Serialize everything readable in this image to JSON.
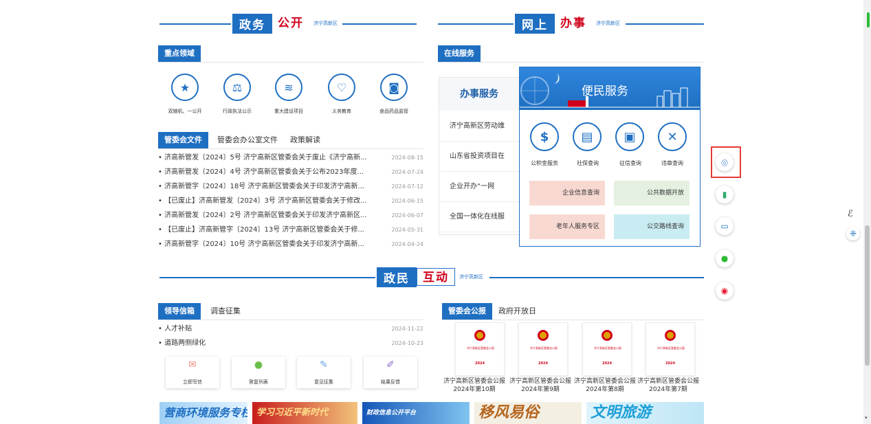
{
  "sections": {
    "gov_open": {
      "title_a": "政务",
      "title_b": "公开",
      "sub": "济宁高新区"
    },
    "online": {
      "title_a": "网上",
      "title_b": "办事",
      "sub": "济宁高新区"
    },
    "interact": {
      "title_a": "政民",
      "title_b": "互动",
      "sub": "济宁高新区"
    }
  },
  "key_areas": {
    "tab": "重点领域",
    "items": [
      {
        "label": "双随机、一公开",
        "icon": "star-badge-icon"
      },
      {
        "label": "行政执法公示",
        "icon": "gavel-icon"
      },
      {
        "label": "重大建设项目",
        "icon": "layers-icon"
      },
      {
        "label": "义务教育",
        "icon": "heart-icon"
      },
      {
        "label": "食品药品监管",
        "icon": "monitor-icon"
      }
    ]
  },
  "docs": {
    "tabs": [
      "管委会文件",
      "管委会办公室文件",
      "政策解读"
    ],
    "items": [
      {
        "title": "• 济高新管发〔2024〕5号 济宁高新区管委会关于废止《济宁高新...",
        "date": "2024-08-15"
      },
      {
        "title": "• 济高新管发〔2024〕4号 济宁高新区管委会关于公布2023年度...",
        "date": "2024-07-24"
      },
      {
        "title": "• 济高新管字〔2024〕18号 济宁高新区管委会关于印发济宁高新...",
        "date": "2024-07-12"
      },
      {
        "title": "• 【已废止】济高新管发〔2024〕3号 济宁高新区管委会关于修改...",
        "date": "2024-06-15"
      },
      {
        "title": "• 济高新管发〔2024〕2号 济宁高新区管委会关于印发济宁高新区...",
        "date": "2024-06-07"
      },
      {
        "title": "• 【已废止】济高新管字〔2024〕13号 济宁高新区管委会关于修...",
        "date": "2024-05-31"
      },
      {
        "title": "• 济高新管字〔2024〕10号 济宁高新区管委会关于印发济宁高新...",
        "date": "2024-04-24"
      }
    ]
  },
  "online_service": {
    "tab": "在线服务",
    "header": "办事服务",
    "rows": [
      "济宁高新区劳动维",
      "山东省投资项目在",
      "企业开办“一网",
      "全国一体化在线服"
    ]
  },
  "convenience": {
    "title": "便民服务",
    "items": [
      {
        "label": "公积金服务",
        "icon": "dollar-search-icon"
      },
      {
        "label": "社保查询",
        "icon": "id-card-icon"
      },
      {
        "label": "征信查询",
        "icon": "profile-card-icon"
      },
      {
        "label": "违章查询",
        "icon": "tools-icon"
      }
    ],
    "queries": [
      "企业信息查询",
      "公共数据开放",
      "老年人服务专区",
      "公交路线查询"
    ]
  },
  "leader_mail": {
    "tabs": [
      "领导信箱",
      "调查征集"
    ],
    "items": [
      {
        "title": "• 人才补贴",
        "date": "2024-11-22"
      },
      {
        "title": "• 道路两侧绿化",
        "date": "2024-10-23"
      }
    ],
    "actions": [
      {
        "label": "立即写信",
        "icon": "envelope-icon"
      },
      {
        "label": "答复列表",
        "icon": "microphone-icon"
      },
      {
        "label": "意见征集",
        "icon": "edit-doc-icon"
      },
      {
        "label": "结果反馈",
        "icon": "pen-icon"
      }
    ]
  },
  "bulletin": {
    "tabs": [
      "管委会公报",
      "政府开放日"
    ],
    "cover_head": "济宁高新区管委会公报",
    "cover_year": "2024",
    "items": [
      {
        "caption": "济宁高新区管委会公报2024年第10期"
      },
      {
        "caption": "济宁高新区管委会公报2024年第9期"
      },
      {
        "caption": "济宁高新区管委会公报2024年第8期"
      },
      {
        "caption": "济宁高新区管委会公报2024年第7期"
      }
    ]
  },
  "banners": [
    {
      "text": "营商环境服务专栏",
      "color": "#1e6fc2"
    },
    {
      "text": "学习习近平新时代",
      "color": "#d0021b"
    },
    {
      "text": "财政信息公开平台",
      "color": "#1e6fc2"
    },
    {
      "text": "移风易俗",
      "color": "#b5651d"
    },
    {
      "text": "文明旅游",
      "color": "#1e9fd8"
    }
  ],
  "side_tools": [
    {
      "name": "robot-icon",
      "glyph": "🤖"
    },
    {
      "name": "tablet-icon",
      "glyph": "▮"
    },
    {
      "name": "desktop-icon",
      "glyph": "🖥"
    },
    {
      "name": "wechat-icon",
      "glyph": "💬"
    },
    {
      "name": "weibo-icon",
      "glyph": "◉"
    }
  ],
  "accessibility": {
    "icon1": "ℰ",
    "icon2": "⁜"
  }
}
